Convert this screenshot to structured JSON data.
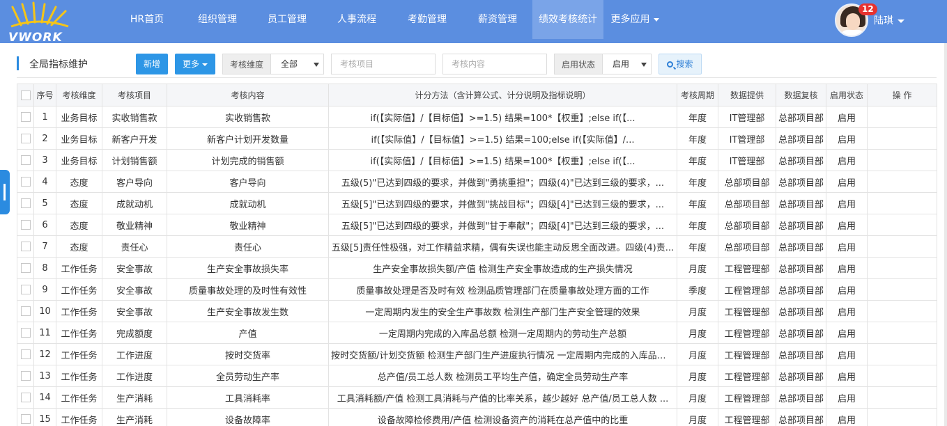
{
  "app": {
    "logo_text": "VWORK",
    "user_name": "陆琪",
    "notifications": "12"
  },
  "nav": [
    {
      "label": "HR首页",
      "active": false
    },
    {
      "label": "组织管理",
      "active": false
    },
    {
      "label": "员工管理",
      "active": false
    },
    {
      "label": "人事流程",
      "active": false
    },
    {
      "label": "考勤管理",
      "active": false
    },
    {
      "label": "薪资管理",
      "active": false
    },
    {
      "label": "绩效考核统计",
      "active": true
    },
    {
      "label": "更多应用",
      "active": false,
      "dropdown": true
    }
  ],
  "toolbar": {
    "title": "全局指标维护",
    "add_label": "新增",
    "more_label": "更多",
    "dimension_label": "考核维度",
    "dimension_value": "全部",
    "item_placeholder": "考核项目",
    "content_placeholder": "考核内容",
    "status_label": "启用状态",
    "status_value": "启用",
    "search_label": "搜索"
  },
  "table": {
    "columns": [
      "序号",
      "考核维度",
      "考核项目",
      "考核内容",
      "计分方法（含计算公式、计分说明及指标说明）",
      "考核周期",
      "数据提供",
      "数据复核",
      "启用状态",
      "操 作"
    ],
    "rows": [
      [
        "1",
        "业务目标",
        "实收销售款",
        "实收销售款",
        "if(【实际值】/【目标值】>=1.5) 结果=100*【权重】;else if(【...",
        "年度",
        "IT管理部",
        "总部项目部",
        "启用",
        ""
      ],
      [
        "2",
        "业务目标",
        "新客户开发",
        "新客户计划开发数量",
        "if(【实际值】/【目标值】>=1.5) 结果=100;else if(【实际值】/...",
        "年度",
        "IT管理部",
        "总部项目部",
        "启用",
        ""
      ],
      [
        "3",
        "业务目标",
        "计划销售额",
        "计划完成的销售额",
        "if(【实际值】/【目标值】>=1.5) 结果=100*【权重】;else if(【...",
        "年度",
        "IT管理部",
        "总部项目部",
        "启用",
        ""
      ],
      [
        "4",
        "态度",
        "客户导向",
        "客户导向",
        "五级(5)\"已达到四级的要求，并做到\"勇挑重担\"；四级(4)\"已达到三级的要求，...",
        "年度",
        "总部项目部",
        "总部项目部",
        "启用",
        ""
      ],
      [
        "5",
        "态度",
        "成就动机",
        "成就动机",
        "五级[5]\"已达到四级的要求，并做到\"挑战目标\"；四级[4]\"已达到三级的要求，...",
        "年度",
        "总部项目部",
        "总部项目部",
        "启用",
        ""
      ],
      [
        "6",
        "态度",
        "敬业精神",
        "敬业精神",
        "五级[5]\"已达到四级的要求，并做到\"甘于奉献\"；四级[4]\"已达到三级的要求，...",
        "年度",
        "总部项目部",
        "总部项目部",
        "启用",
        ""
      ],
      [
        "7",
        "态度",
        "责任心",
        "责任心",
        "五级[5]责任性极强，对工作精益求精，偶有失误也能主动反思全面改进。四级(4)责...",
        "年度",
        "总部项目部",
        "总部项目部",
        "启用",
        ""
      ],
      [
        "8",
        "工作任务",
        "安全事故",
        "生产安全事故损失率",
        "生产安全事故损失额/产值 检测生产安全事故造成的生产损失情况",
        "月度",
        "工程管理部",
        "总部项目部",
        "启用",
        ""
      ],
      [
        "9",
        "工作任务",
        "安全事故",
        "质量事故处理的及时性有效性",
        "质量事故处理是否及时有效 检测品质管理部门在质量事故处理方面的工作",
        "季度",
        "工程管理部",
        "总部项目部",
        "启用",
        ""
      ],
      [
        "10",
        "工作任务",
        "安全事故",
        "生产安全事故发生数",
        "一定周期内发生的安全生产事故数 检测生产部门生产安全管理的效果",
        "月度",
        "工程管理部",
        "总部项目部",
        "启用",
        ""
      ],
      [
        "11",
        "工作任务",
        "完成额度",
        "产值",
        "一定周期内完成的入库品总额 检测一定周期内的劳动生产总额",
        "月度",
        "工程管理部",
        "总部项目部",
        "启用",
        ""
      ],
      [
        "12",
        "工作任务",
        "工作进度",
        "按时交货率",
        "按时交货额/计划交货额 检测生产部门生产进度执行情况 一定周期内完成的入库品总...",
        "月度",
        "工程管理部",
        "总部项目部",
        "启用",
        ""
      ],
      [
        "13",
        "工作任务",
        "工作进度",
        "全员劳动生产率",
        "总产值/员工总人数 检测员工平均生产值，确定全员劳动生产率",
        "月度",
        "工程管理部",
        "总部项目部",
        "启用",
        ""
      ],
      [
        "14",
        "工作任务",
        "生产消耗",
        "工具消耗率",
        "工具消耗额/产值 检测工具消耗与产值的比率关系，越少越好 总产值/员工总人数 ...",
        "月度",
        "工程管理部",
        "总部项目部",
        "启用",
        ""
      ],
      [
        "15",
        "工作任务",
        "生产消耗",
        "设备故障率",
        "设备故障检修费用/产值 检测设备资产的消耗在总产值中的比重",
        "月度",
        "工程管理部",
        "总部项目部",
        "启用",
        ""
      ]
    ]
  },
  "colors": {
    "nav_bg": "#5b8ee0",
    "nav_active": "#7aa4e8",
    "primary_button": "#2d96e6",
    "badge": "#e8322f"
  }
}
